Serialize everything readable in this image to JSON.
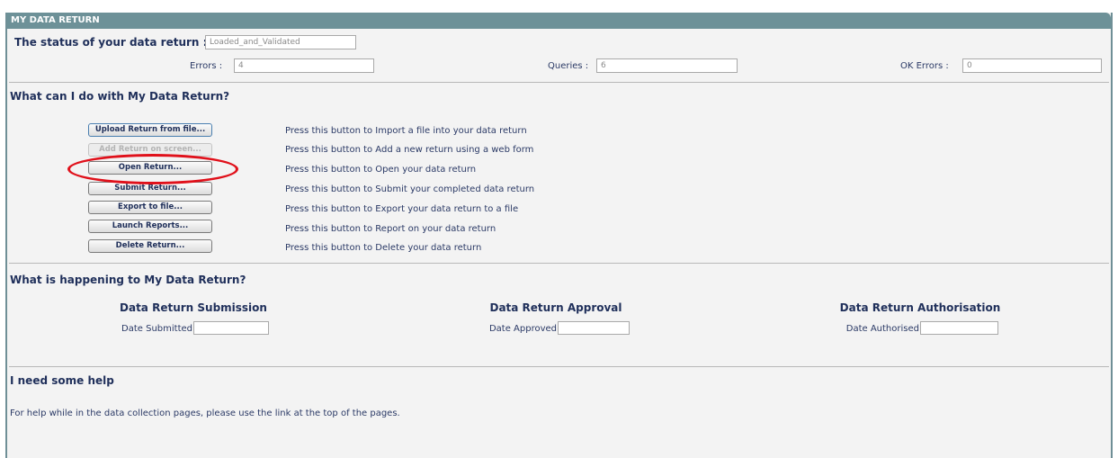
{
  "panel": {
    "title": "MY DATA RETURN"
  },
  "status": {
    "label": "The status of your data return :",
    "value": "Loaded_and_Validated",
    "errors_label": "Errors :",
    "errors_value": "4",
    "queries_label": "Queries :",
    "queries_value": "6",
    "ok_errors_label": "OK Errors :",
    "ok_errors_value": "0"
  },
  "actions": {
    "heading": "What can I do with My Data Return?",
    "items": [
      {
        "button": "Upload Return from file...",
        "description": "Press this button to Import a file into your data return"
      },
      {
        "button": "Add Return on screen...",
        "description": "Press this button to Add a new return using a web form"
      },
      {
        "button": "Open Return...",
        "description": "Press this button to Open your data return"
      },
      {
        "button": "Submit Return...",
        "description": "Press this button to Submit your completed data return"
      },
      {
        "button": "Export to file...",
        "description": "Press this button to Export your data return to a file"
      },
      {
        "button": "Launch Reports...",
        "description": "Press this button to Report on your data return"
      },
      {
        "button": "Delete Return...",
        "description": "Press this button to Delete your data return"
      }
    ]
  },
  "happening": {
    "heading": "What is happening to My Data Return?",
    "submission": {
      "title": "Data Return Submission",
      "label": "Date Submitted",
      "value": ""
    },
    "approval": {
      "title": "Data Return Approval",
      "label": "Date Approved",
      "value": ""
    },
    "authorisation": {
      "title": "Data Return Authorisation",
      "label": "Date Authorised",
      "value": ""
    }
  },
  "help": {
    "heading": "I need some help",
    "text": "For help while in the data collection pages, please use the link at the top of the pages."
  },
  "colors": {
    "titlebar": "#6d9198",
    "highlight_ellipse": "#e0101a",
    "text": "#1f2f5a"
  }
}
